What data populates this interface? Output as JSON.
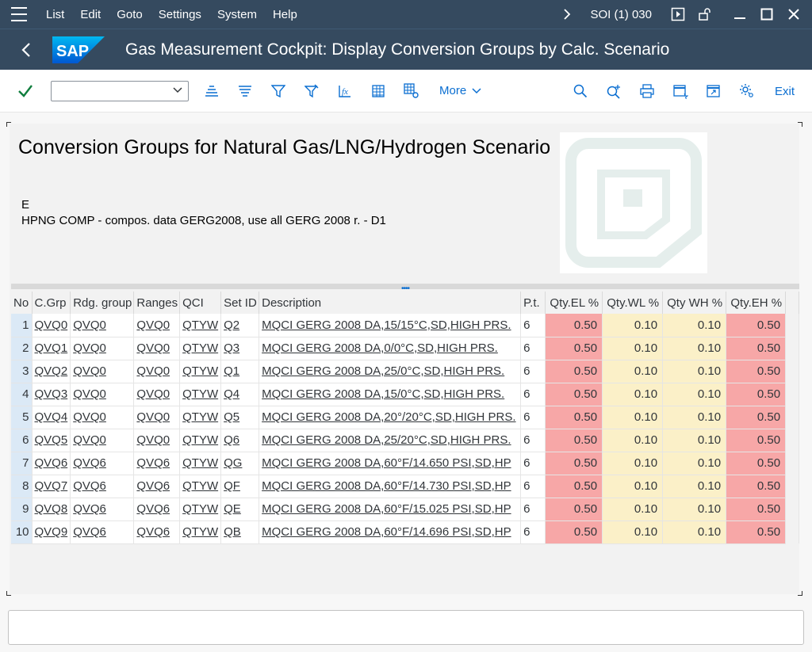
{
  "menu": {
    "items": [
      "List",
      "Edit",
      "Goto",
      "Settings",
      "System",
      "Help"
    ],
    "system_info": "SOI (1) 030"
  },
  "titlebar": {
    "logo_text": "SAP",
    "title": "Gas Measurement Cockpit: Display Conversion Groups by Calc. Scenario"
  },
  "toolbar": {
    "combo_value": "",
    "more_label": "More",
    "exit_label": "Exit"
  },
  "header": {
    "title": "Conversion Groups for Natural Gas/LNG/Hydrogen Scenario",
    "line1": "E",
    "line2": "HPNG COMP - compos. data GERG2008, use all GERG 2008 r. - D1"
  },
  "table": {
    "columns": [
      "No",
      "C.Grp",
      "Rdg. group",
      "Ranges",
      "QCI",
      "Set ID",
      "Description",
      "P.t.",
      "Qty.EL %",
      "Qty.WL %",
      "Qty WH %",
      "Qty.EH %"
    ],
    "rows": [
      {
        "no": "1",
        "cgrp": "QVQ0",
        "rdg": "QVQ0",
        "ranges": "QVQ0",
        "qci": "QTYW",
        "setid": "Q2",
        "desc": "MQCI GERG 2008 DA,15/15°C,SD,HIGH PRS.",
        "pt": "6",
        "el": "0.50",
        "wl": "0.10",
        "wh": "0.10",
        "eh": "0.50"
      },
      {
        "no": "2",
        "cgrp": "QVQ1",
        "rdg": "QVQ0",
        "ranges": "QVQ0",
        "qci": "QTYW",
        "setid": "Q3",
        "desc": "MQCI GERG 2008 DA,0/0°C,SD,HIGH PRS.",
        "pt": "6",
        "el": "0.50",
        "wl": "0.10",
        "wh": "0.10",
        "eh": "0.50"
      },
      {
        "no": "3",
        "cgrp": "QVQ2",
        "rdg": "QVQ0",
        "ranges": "QVQ0",
        "qci": "QTYW",
        "setid": "Q1",
        "desc": "MQCI GERG 2008 DA,25/0°C,SD,HIGH PRS.",
        "pt": "6",
        "el": "0.50",
        "wl": "0.10",
        "wh": "0.10",
        "eh": "0.50"
      },
      {
        "no": "4",
        "cgrp": "QVQ3",
        "rdg": "QVQ0",
        "ranges": "QVQ0",
        "qci": "QTYW",
        "setid": "Q4",
        "desc": "MQCI GERG 2008 DA,15/0°C,SD,HIGH PRS.",
        "pt": "6",
        "el": "0.50",
        "wl": "0.10",
        "wh": "0.10",
        "eh": "0.50"
      },
      {
        "no": "5",
        "cgrp": "QVQ4",
        "rdg": "QVQ0",
        "ranges": "QVQ0",
        "qci": "QTYW",
        "setid": "Q5",
        "desc": "MQCI GERG 2008 DA,20°/20°C,SD,HIGH PRS.",
        "pt": "6",
        "el": "0.50",
        "wl": "0.10",
        "wh": "0.10",
        "eh": "0.50"
      },
      {
        "no": "6",
        "cgrp": "QVQ5",
        "rdg": "QVQ0",
        "ranges": "QVQ0",
        "qci": "QTYW",
        "setid": "Q6",
        "desc": "MQCI GERG 2008 DA,25/20°C,SD,HIGH PRS.",
        "pt": "6",
        "el": "0.50",
        "wl": "0.10",
        "wh": "0.10",
        "eh": "0.50"
      },
      {
        "no": "7",
        "cgrp": "QVQ6",
        "rdg": "QVQ6",
        "ranges": "QVQ6",
        "qci": "QTYW",
        "setid": "QG",
        "desc": "MQCI GERG 2008 DA,60°F/14.650 PSI,SD,HP",
        "pt": "6",
        "el": "0.50",
        "wl": "0.10",
        "wh": "0.10",
        "eh": "0.50"
      },
      {
        "no": "8",
        "cgrp": "QVQ7",
        "rdg": "QVQ6",
        "ranges": "QVQ6",
        "qci": "QTYW",
        "setid": "QF",
        "desc": "MQCI GERG 2008 DA,60°F/14.730 PSI,SD,HP",
        "pt": "6",
        "el": "0.50",
        "wl": "0.10",
        "wh": "0.10",
        "eh": "0.50"
      },
      {
        "no": "9",
        "cgrp": "QVQ8",
        "rdg": "QVQ6",
        "ranges": "QVQ6",
        "qci": "QTYW",
        "setid": "QE",
        "desc": "MQCI GERG 2008 DA,60°F/15.025 PSI,SD,HP",
        "pt": "6",
        "el": "0.50",
        "wl": "0.10",
        "wh": "0.10",
        "eh": "0.50"
      },
      {
        "no": "10",
        "cgrp": "QVQ9",
        "rdg": "QVQ6",
        "ranges": "QVQ6",
        "qci": "QTYW",
        "setid": "QB",
        "desc": "MQCI GERG 2008 DA,60°F/14.696 PSI,SD,HP",
        "pt": "6",
        "el": "0.50",
        "wl": "0.10",
        "wh": "0.10",
        "eh": "0.50"
      }
    ]
  },
  "colors": {
    "shell": "#354a5f",
    "link_blue": "#0a6ed1",
    "critical_cell": "#f7a7a7",
    "warning_cell": "#fbf0c8",
    "row_no_cell": "#dbe9f6"
  },
  "statusbar": {
    "message": ""
  }
}
